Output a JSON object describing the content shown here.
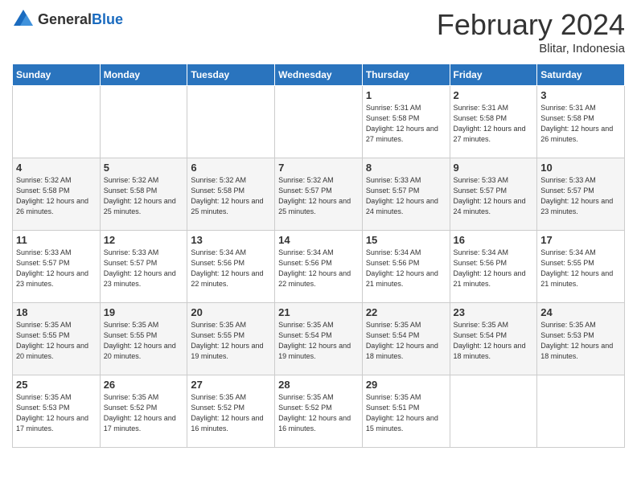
{
  "header": {
    "logo_general": "General",
    "logo_blue": "Blue",
    "month_year": "February 2024",
    "location": "Blitar, Indonesia"
  },
  "weekdays": [
    "Sunday",
    "Monday",
    "Tuesday",
    "Wednesday",
    "Thursday",
    "Friday",
    "Saturday"
  ],
  "weeks": [
    [
      {
        "day": "",
        "info": ""
      },
      {
        "day": "",
        "info": ""
      },
      {
        "day": "",
        "info": ""
      },
      {
        "day": "",
        "info": ""
      },
      {
        "day": "1",
        "info": "Sunrise: 5:31 AM\nSunset: 5:58 PM\nDaylight: 12 hours and 27 minutes."
      },
      {
        "day": "2",
        "info": "Sunrise: 5:31 AM\nSunset: 5:58 PM\nDaylight: 12 hours and 27 minutes."
      },
      {
        "day": "3",
        "info": "Sunrise: 5:31 AM\nSunset: 5:58 PM\nDaylight: 12 hours and 26 minutes."
      }
    ],
    [
      {
        "day": "4",
        "info": "Sunrise: 5:32 AM\nSunset: 5:58 PM\nDaylight: 12 hours and 26 minutes."
      },
      {
        "day": "5",
        "info": "Sunrise: 5:32 AM\nSunset: 5:58 PM\nDaylight: 12 hours and 25 minutes."
      },
      {
        "day": "6",
        "info": "Sunrise: 5:32 AM\nSunset: 5:58 PM\nDaylight: 12 hours and 25 minutes."
      },
      {
        "day": "7",
        "info": "Sunrise: 5:32 AM\nSunset: 5:57 PM\nDaylight: 12 hours and 25 minutes."
      },
      {
        "day": "8",
        "info": "Sunrise: 5:33 AM\nSunset: 5:57 PM\nDaylight: 12 hours and 24 minutes."
      },
      {
        "day": "9",
        "info": "Sunrise: 5:33 AM\nSunset: 5:57 PM\nDaylight: 12 hours and 24 minutes."
      },
      {
        "day": "10",
        "info": "Sunrise: 5:33 AM\nSunset: 5:57 PM\nDaylight: 12 hours and 23 minutes."
      }
    ],
    [
      {
        "day": "11",
        "info": "Sunrise: 5:33 AM\nSunset: 5:57 PM\nDaylight: 12 hours and 23 minutes."
      },
      {
        "day": "12",
        "info": "Sunrise: 5:33 AM\nSunset: 5:57 PM\nDaylight: 12 hours and 23 minutes."
      },
      {
        "day": "13",
        "info": "Sunrise: 5:34 AM\nSunset: 5:56 PM\nDaylight: 12 hours and 22 minutes."
      },
      {
        "day": "14",
        "info": "Sunrise: 5:34 AM\nSunset: 5:56 PM\nDaylight: 12 hours and 22 minutes."
      },
      {
        "day": "15",
        "info": "Sunrise: 5:34 AM\nSunset: 5:56 PM\nDaylight: 12 hours and 21 minutes."
      },
      {
        "day": "16",
        "info": "Sunrise: 5:34 AM\nSunset: 5:56 PM\nDaylight: 12 hours and 21 minutes."
      },
      {
        "day": "17",
        "info": "Sunrise: 5:34 AM\nSunset: 5:55 PM\nDaylight: 12 hours and 21 minutes."
      }
    ],
    [
      {
        "day": "18",
        "info": "Sunrise: 5:35 AM\nSunset: 5:55 PM\nDaylight: 12 hours and 20 minutes."
      },
      {
        "day": "19",
        "info": "Sunrise: 5:35 AM\nSunset: 5:55 PM\nDaylight: 12 hours and 20 minutes."
      },
      {
        "day": "20",
        "info": "Sunrise: 5:35 AM\nSunset: 5:55 PM\nDaylight: 12 hours and 19 minutes."
      },
      {
        "day": "21",
        "info": "Sunrise: 5:35 AM\nSunset: 5:54 PM\nDaylight: 12 hours and 19 minutes."
      },
      {
        "day": "22",
        "info": "Sunrise: 5:35 AM\nSunset: 5:54 PM\nDaylight: 12 hours and 18 minutes."
      },
      {
        "day": "23",
        "info": "Sunrise: 5:35 AM\nSunset: 5:54 PM\nDaylight: 12 hours and 18 minutes."
      },
      {
        "day": "24",
        "info": "Sunrise: 5:35 AM\nSunset: 5:53 PM\nDaylight: 12 hours and 18 minutes."
      }
    ],
    [
      {
        "day": "25",
        "info": "Sunrise: 5:35 AM\nSunset: 5:53 PM\nDaylight: 12 hours and 17 minutes."
      },
      {
        "day": "26",
        "info": "Sunrise: 5:35 AM\nSunset: 5:52 PM\nDaylight: 12 hours and 17 minutes."
      },
      {
        "day": "27",
        "info": "Sunrise: 5:35 AM\nSunset: 5:52 PM\nDaylight: 12 hours and 16 minutes."
      },
      {
        "day": "28",
        "info": "Sunrise: 5:35 AM\nSunset: 5:52 PM\nDaylight: 12 hours and 16 minutes."
      },
      {
        "day": "29",
        "info": "Sunrise: 5:35 AM\nSunset: 5:51 PM\nDaylight: 12 hours and 15 minutes."
      },
      {
        "day": "",
        "info": ""
      },
      {
        "day": "",
        "info": ""
      }
    ]
  ]
}
